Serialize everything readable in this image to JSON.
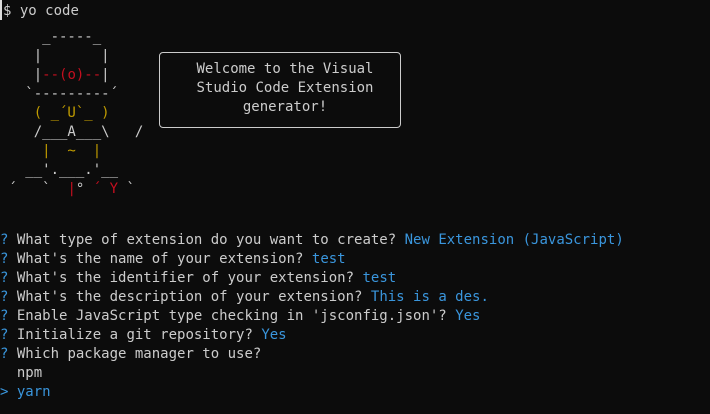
{
  "command": {
    "prompt": "$",
    "text": "yo code"
  },
  "ascii_art": {
    "l1": "     _-----_",
    "l2a": "    |       |",
    "l3a": "    |",
    "l3b": "--(o)--",
    "l3c": "|",
    "l4": "   `---------´",
    "l5": "    ( _´U`_ )",
    "l6": "    /___A___\\   /",
    "l7": "     |  ~  |",
    "l8": "   __'.___.'__",
    "l9a": " ´   `  ",
    "l9b": "|",
    "l9c": "° ",
    "l9d": "´ Y",
    "l9e": " `"
  },
  "welcome": {
    "line1": "Welcome to the Visual",
    "line2": "Studio Code Extension",
    "line3": "generator!"
  },
  "questions": [
    {
      "mark": "?",
      "question": "What type of extension do you want to create?",
      "answer": "New Extension (JavaScript)"
    },
    {
      "mark": "?",
      "question": "What's the name of your extension?",
      "answer": "test"
    },
    {
      "mark": "?",
      "question": "What's the identifier of your extension?",
      "answer": "test"
    },
    {
      "mark": "?",
      "question": "What's the description of your extension?",
      "answer": "This is a des."
    },
    {
      "mark": "?",
      "question": "Enable JavaScript type checking in 'jsconfig.json'?",
      "answer": "Yes"
    },
    {
      "mark": "?",
      "question": "Initialize a git repository?",
      "answer": "Yes"
    },
    {
      "mark": "?",
      "question": "Which package manager to use?",
      "answer": ""
    }
  ],
  "options": [
    {
      "pointer": "",
      "label": "npm"
    },
    {
      "pointer": ">",
      "label": "yarn"
    }
  ]
}
